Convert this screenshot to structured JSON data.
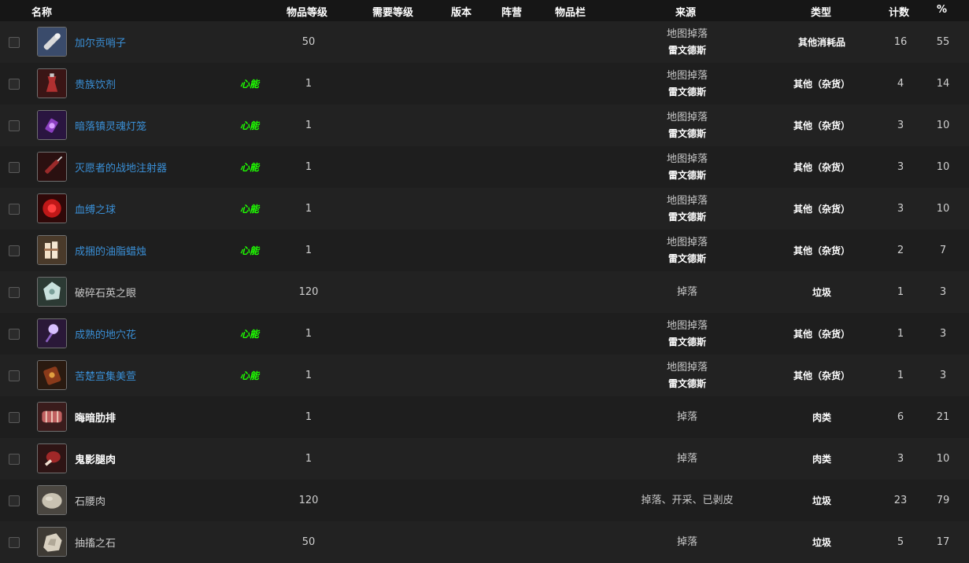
{
  "headers": {
    "name": "名称",
    "item_level": "物品等级",
    "req_level": "需要等级",
    "version": "版本",
    "faction": "阵营",
    "slot": "物品栏",
    "source": "来源",
    "type": "类型",
    "count": "计数",
    "percent": "%"
  },
  "colors": {
    "link_blue": "#3a8fd6",
    "tag_green": "#1eff00",
    "background": "#1c1c1c"
  },
  "rows": [
    {
      "icon": "whistle-icon",
      "name": "加尔贡哨子",
      "name_style": "blue",
      "tag": "",
      "ilvl": "50",
      "src1": "地图掉落",
      "src2": "雷文德斯",
      "type": "其他消耗品",
      "count": "16",
      "pct": "55"
    },
    {
      "icon": "drink-icon",
      "name": "贵族饮剂",
      "name_style": "blue",
      "tag": "心能",
      "ilvl": "1",
      "src1": "地图掉落",
      "src2": "雷文德斯",
      "type": "其他（杂货）",
      "count": "4",
      "pct": "14"
    },
    {
      "icon": "lantern-icon",
      "name": "暗落镇灵魂灯笼",
      "name_style": "blue",
      "tag": "心能",
      "ilvl": "1",
      "src1": "地图掉落",
      "src2": "雷文德斯",
      "type": "其他（杂货）",
      "count": "3",
      "pct": "10"
    },
    {
      "icon": "syringe-icon",
      "name": "灭愿者的战地注射器",
      "name_style": "blue",
      "tag": "心能",
      "ilvl": "1",
      "src1": "地图掉落",
      "src2": "雷文德斯",
      "type": "其他（杂货）",
      "count": "3",
      "pct": "10"
    },
    {
      "icon": "blood-orb-icon",
      "name": "血缚之球",
      "name_style": "blue",
      "tag": "心能",
      "ilvl": "1",
      "src1": "地图掉落",
      "src2": "雷文德斯",
      "type": "其他（杂货）",
      "count": "3",
      "pct": "10"
    },
    {
      "icon": "candle-icon",
      "name": "成捆的油脂蜡烛",
      "name_style": "blue",
      "tag": "心能",
      "ilvl": "1",
      "src1": "地图掉落",
      "src2": "雷文德斯",
      "type": "其他（杂货）",
      "count": "2",
      "pct": "7"
    },
    {
      "icon": "crystal-eye-icon",
      "name": "破碎石英之眼",
      "name_style": "gray",
      "tag": "",
      "ilvl": "120",
      "src1": "掉落",
      "src2": "",
      "type": "垃圾",
      "count": "1",
      "pct": "3"
    },
    {
      "icon": "cave-flower-icon",
      "name": "成熟的地穴花",
      "name_style": "blue",
      "tag": "心能",
      "ilvl": "1",
      "src1": "地图掉落",
      "src2": "雷文德斯",
      "type": "其他（杂货）",
      "count": "1",
      "pct": "3"
    },
    {
      "icon": "amber-icon",
      "name": "苦楚宣集美萱",
      "name_style": "blue",
      "tag": "心能",
      "ilvl": "1",
      "src1": "地图掉落",
      "src2": "雷文德斯",
      "type": "其他（杂货）",
      "count": "1",
      "pct": "3"
    },
    {
      "icon": "ribs-icon",
      "name": "晦暗肋排",
      "name_style": "white",
      "tag": "",
      "ilvl": "1",
      "src1": "掉落",
      "src2": "",
      "type": "肉类",
      "count": "6",
      "pct": "21"
    },
    {
      "icon": "meat-leg-icon",
      "name": "鬼影腿肉",
      "name_style": "white",
      "tag": "",
      "ilvl": "1",
      "src1": "掉落",
      "src2": "",
      "type": "肉类",
      "count": "3",
      "pct": "10"
    },
    {
      "icon": "stone-meat-icon",
      "name": "石腰肉",
      "name_style": "gray",
      "tag": "",
      "ilvl": "120",
      "src1": "掉落、开采、已剥皮",
      "src2": "",
      "type": "垃圾",
      "count": "23",
      "pct": "79"
    },
    {
      "icon": "stone-icon",
      "name": "抽搐之石",
      "name_style": "gray",
      "tag": "",
      "ilvl": "50",
      "src1": "掉落",
      "src2": "",
      "type": "垃圾",
      "count": "5",
      "pct": "17"
    }
  ]
}
